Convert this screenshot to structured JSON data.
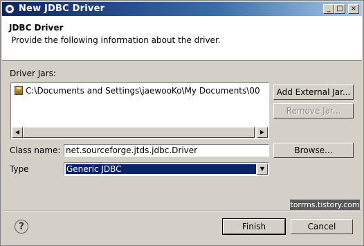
{
  "window": {
    "title": "New JDBC Driver",
    "controls": {
      "minimize": "_",
      "maximize": "□",
      "close": "×"
    }
  },
  "header": {
    "title": "JDBC Driver",
    "description": "Provide the following information about the driver."
  },
  "driver_jars": {
    "label": "Driver Jars:",
    "items": [
      {
        "icon": "jar-file-icon",
        "path": "C:\\Documents and Settings\\jaewooKo\\My Documents\\00"
      }
    ],
    "buttons": {
      "add_external": "Add External Jar...",
      "remove": "Remove Jar..."
    }
  },
  "class_name": {
    "label": "Class name:",
    "value": "net.sourceforge.jtds.jdbc.Driver",
    "browse": "Browse..."
  },
  "type": {
    "label": "Type",
    "selected": "Generic JDBC"
  },
  "watermark": "torrms.tistory.com",
  "footer": {
    "help_glyph": "?",
    "finish": "Finish",
    "cancel": "Cancel"
  }
}
